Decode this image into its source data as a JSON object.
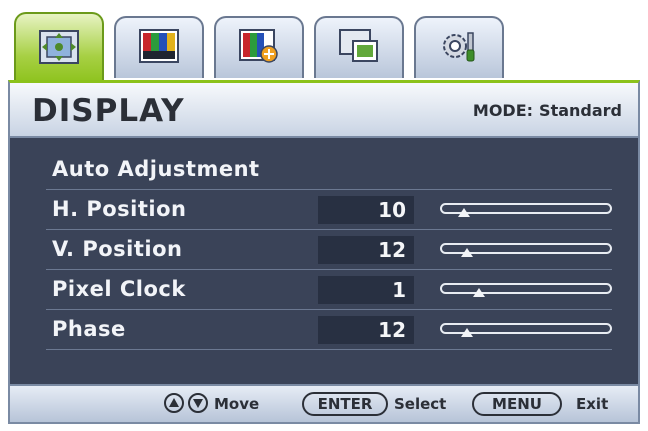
{
  "tabs": [
    {
      "name": "display",
      "icon": "display-adjust-icon",
      "active": true
    },
    {
      "name": "picture",
      "icon": "picture-bars-icon",
      "active": false
    },
    {
      "name": "picture-advanced",
      "icon": "picture-advanced-icon",
      "active": false
    },
    {
      "name": "pip",
      "icon": "pip-window-icon",
      "active": false
    },
    {
      "name": "system",
      "icon": "system-settings-icon",
      "active": false
    }
  ],
  "header": {
    "title": "DISPLAY",
    "mode_label": "MODE:",
    "mode_value": "Standard"
  },
  "menu": {
    "auto_adjustment": "Auto Adjustment",
    "items": [
      {
        "label": "H. Position",
        "value": "10",
        "level": 0.1
      },
      {
        "label": "V. Position",
        "value": "12",
        "level": 0.12
      },
      {
        "label": "Pixel Clock",
        "value": "1",
        "level": 0.2
      },
      {
        "label": "Phase",
        "value": "12",
        "level": 0.12
      }
    ]
  },
  "footer": {
    "move_label": "Move",
    "enter_key": "ENTER",
    "select_label": "Select",
    "menu_key": "MENU",
    "exit_label": "Exit"
  },
  "colors": {
    "accent": "#8cc21b",
    "panel": "#3a4358",
    "value_box": "#283042"
  }
}
